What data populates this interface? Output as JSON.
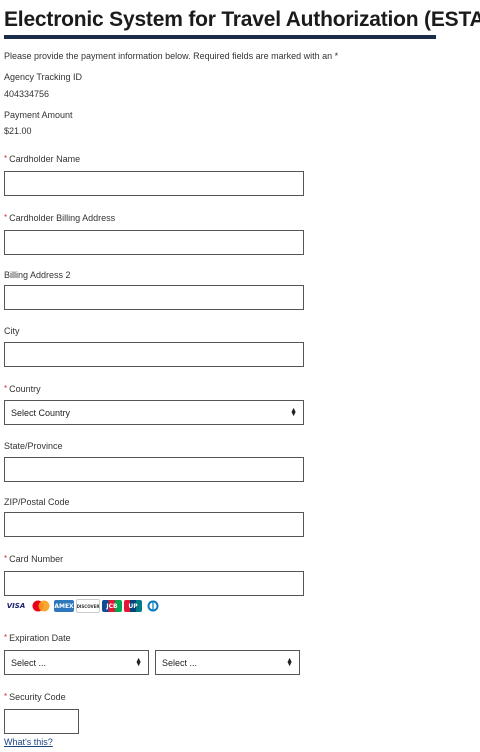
{
  "page": {
    "title": "Electronic System for Travel Authorization (ESTA)",
    "intro": "Please provide the payment information below. Required fields are marked with an *"
  },
  "info": {
    "tracking_label": "Agency Tracking ID",
    "tracking_value": "404334756",
    "amount_label": "Payment Amount",
    "amount_value": "$21.00"
  },
  "required_mark": "*",
  "fields": {
    "cardholder_name": "Cardholder Name",
    "billing_address": "Cardholder Billing Address",
    "billing_address_2": "Billing Address 2",
    "city": "City",
    "country": "Country",
    "country_select": "Select Country",
    "state": "State/Province",
    "zip": "ZIP/Postal Code",
    "card_number": "Card Number",
    "expiration": "Expiration Date",
    "exp_month": "Select ...",
    "exp_year": "Select ...",
    "security_code": "Security Code",
    "whats_this": "What's this?"
  },
  "cards": {
    "visa": "VISA",
    "mastercard": "MC",
    "amex": "AMEX",
    "discover": "DISCOVER",
    "jcb": "JCB",
    "union": "UP",
    "diners": "DC"
  },
  "colors": {
    "rule": "#1b2b4a",
    "required": "#c9302c",
    "link": "#1a4480"
  },
  "icons": {
    "select_arrows": "up-down-caret-icon"
  }
}
